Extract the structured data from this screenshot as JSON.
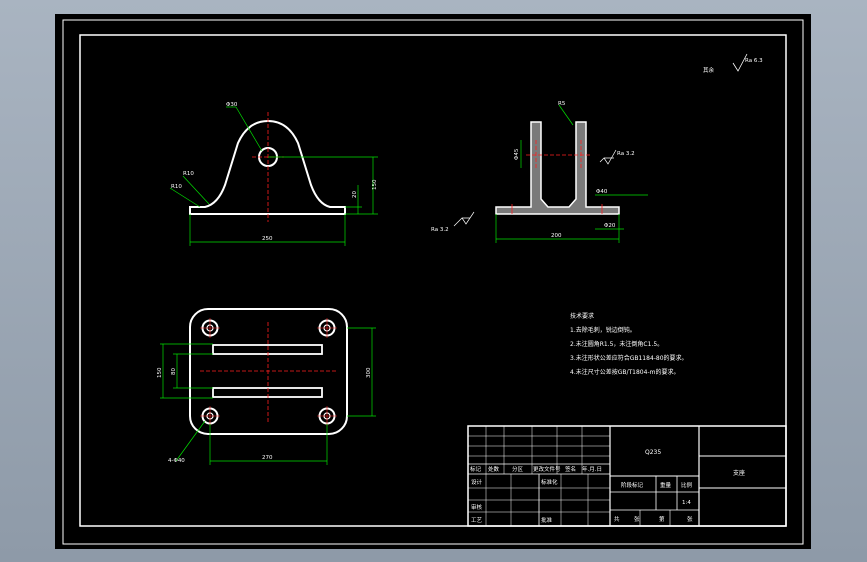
{
  "roughness": {
    "symbol_label": "其余",
    "value": "Ra 6.3"
  },
  "front_view": {
    "hole_dim": "Φ30",
    "radius_dim": "R10",
    "radius_dim2": "R10",
    "height_dim": "150",
    "base_dim": "20",
    "width_dim": "250"
  },
  "side_view": {
    "thick_dim": "R5",
    "slot_dim": "Φ45",
    "roughness_right": "Ra 3.2",
    "roughness_left": "Ra 3.2",
    "dim_40": "Φ40",
    "dim_20": "Φ20",
    "width_dim": "200"
  },
  "top_view": {
    "hole_dim": "4-Φ40",
    "width_dim": "270",
    "height_dim_outer": "150",
    "height_dim_inner": "80",
    "height_dim_right": "300"
  },
  "notes": {
    "title": "技术要求",
    "items": [
      "1.去除毛刺，锐边倒钝。",
      "2.未注圆角R1.5，未注倒角C1.5。",
      "3.未注形状公差应符合GB1184-80的要求。",
      "4.未注尺寸公差按GB/T1804-m的要求。"
    ]
  },
  "title_block": {
    "material": "Q235",
    "part_name": "支座",
    "header_cells": [
      "标记",
      "处数",
      "分区",
      "更改文件号",
      "签名",
      "年.月.日"
    ],
    "design_label": "设计",
    "standardize_label": "标准化",
    "check_label": "审核",
    "process_label": "工艺",
    "approve_label": "批准",
    "stage_label": "阶段标记",
    "weight_label": "重量",
    "scale_label": "比例",
    "scale_value": "1:4",
    "sheets_label": "共",
    "sheet_label": "张",
    "page_label": "第",
    "page_label2": "张"
  }
}
